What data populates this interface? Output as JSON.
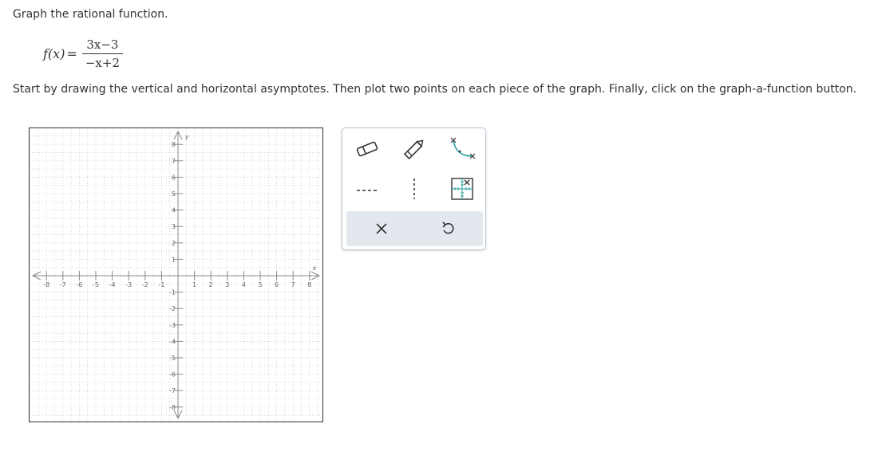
{
  "prompt": "Graph the rational function.",
  "function": {
    "lhs": "f(x)",
    "equals": "=",
    "numerator": "3x−3",
    "denominator": "−x+2"
  },
  "instructions": "Start by drawing the vertical and horizontal asymptotes. Then plot two points on each piece of the graph. Finally, click on the graph-a-function button.",
  "graph": {
    "x_range": [
      -8,
      8
    ],
    "y_range": [
      -8,
      8
    ],
    "x_axis_label": "x",
    "y_axis_label": "y",
    "x_ticks": [
      "-8",
      "-7",
      "-6",
      "-5",
      "-4",
      "-3",
      "-2",
      "-1",
      "1",
      "2",
      "3",
      "4",
      "5",
      "6",
      "7",
      "8"
    ],
    "y_ticks": [
      "8",
      "7",
      "6",
      "5",
      "4",
      "3",
      "2",
      "1",
      "-1",
      "-2",
      "-3",
      "-4",
      "-5",
      "-6",
      "-7",
      "-8"
    ],
    "grid": true
  },
  "tools": {
    "items": [
      "eraser-tool",
      "pencil-tool",
      "curve-tool",
      "dashed-line-tool",
      "vertical-dashed-line-tool",
      "graph-a-function-tool"
    ],
    "footer": [
      "clear-button",
      "undo-button"
    ],
    "colors": {
      "accent": "#1a9a9a",
      "panel_border": "#b8c4d4",
      "footer_bg": "#e3e8ef"
    }
  }
}
